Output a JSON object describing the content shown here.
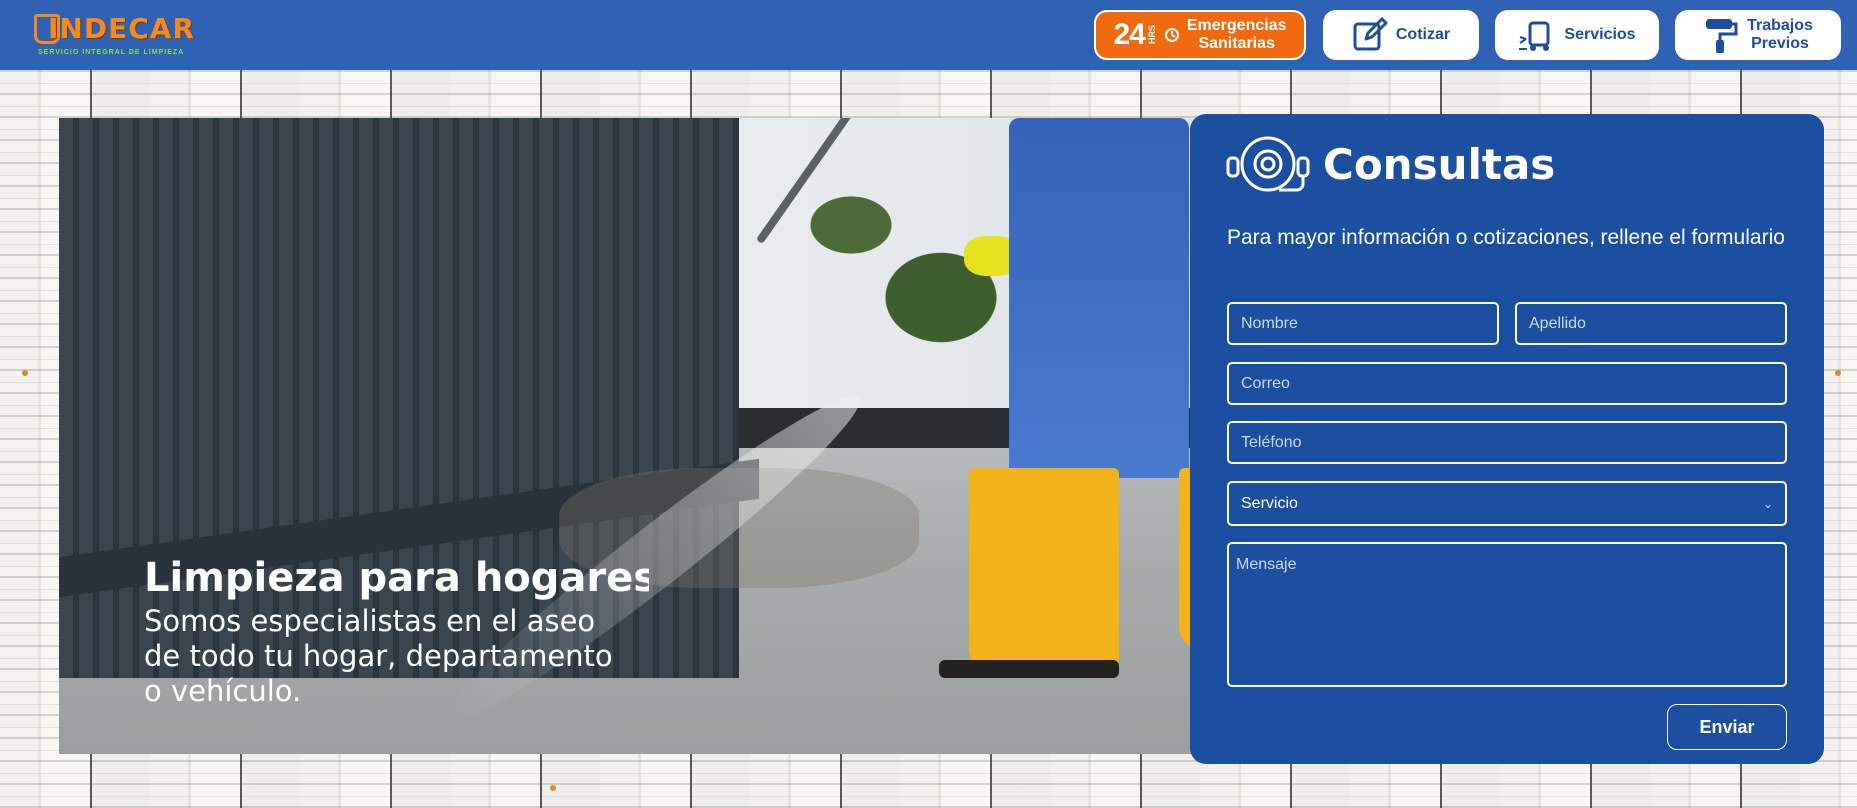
{
  "header": {
    "logo": {
      "name": "INDECAR",
      "tagline": "SERVICIO INTEGRAL DE LIMPIEZA"
    },
    "nav": {
      "emergency": {
        "number": "24",
        "hrs": "HRS",
        "line1": "Emergencias",
        "line2": "Sanitarias",
        "color": "#f26a10"
      },
      "cotizar": {
        "label": "Cotizar"
      },
      "servicios": {
        "label": "Servicios"
      },
      "trabajos": {
        "line1": "Trabajos",
        "line2": "Previos"
      }
    }
  },
  "hero": {
    "title": "Limpieza para hogares",
    "description": [
      "Somos especialistas en el aseo",
      "de todo tu hogar, departamento",
      "o vehículo."
    ]
  },
  "form": {
    "title": "Consultas",
    "subtitle": "Para mayor información o cotizaciones, rellene el formulario",
    "fields": {
      "nombre": "Nombre",
      "apellido": "Apellido",
      "correo": "Correo",
      "telefono": "Teléfono",
      "servicio": "Servicio",
      "mensaje": "Mensaje"
    },
    "submit": "Enviar",
    "panel_color": "#1d4fa0"
  },
  "colors": {
    "header_bg": "#2f62b5",
    "accent_orange": "#f26a10",
    "brand_blue": "#1d4d9c"
  }
}
